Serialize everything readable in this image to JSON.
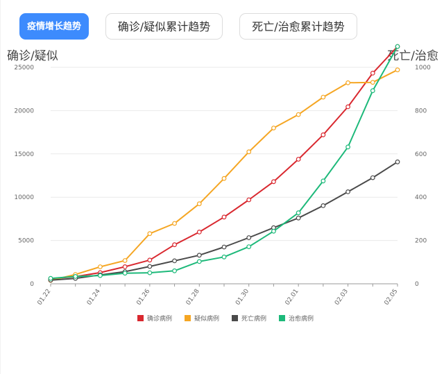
{
  "tabs": [
    {
      "label": "疫情增长趋势",
      "active": true
    },
    {
      "label": "确诊/疑似累计趋势",
      "active": false
    },
    {
      "label": "死亡/治愈累计趋势",
      "active": false
    }
  ],
  "chart_data": {
    "type": "line",
    "left_axis_label": "确诊/疑似",
    "right_axis_label": "死亡/治愈",
    "x": [
      "01.22",
      "01.23",
      "01.24",
      "01.25",
      "01.26",
      "01.27",
      "01.28",
      "01.29",
      "01.30",
      "01.31",
      "02.01",
      "02.02",
      "02.03",
      "02.04",
      "02.05"
    ],
    "x_tick_labels": [
      "01.22",
      "01.24",
      "01.26",
      "01.28",
      "01.30",
      "02.01",
      "02.03",
      "02.05"
    ],
    "left_ylim": [
      0,
      25000
    ],
    "left_ticks": [
      0,
      5000,
      10000,
      15000,
      20000,
      25000
    ],
    "right_ylim": [
      0,
      1000
    ],
    "right_ticks": [
      0,
      200,
      400,
      600,
      800,
      1000
    ],
    "grid": true,
    "legend_position": "bottom",
    "series": [
      {
        "name": "确诊病例",
        "axis": "left",
        "color": "#d9282f",
        "values": [
          571,
          830,
          1287,
          1975,
          2744,
          4515,
          5974,
          7711,
          9692,
          11791,
          14380,
          17205,
          20438,
          24324,
          28018
        ]
      },
      {
        "name": "疑似病例",
        "axis": "left",
        "color": "#f5a623",
        "values": [
          393,
          1072,
          1965,
          2684,
          5794,
          6973,
          9239,
          12167,
          15238,
          17988,
          19544,
          21558,
          23214,
          23260,
          24702
        ]
      },
      {
        "name": "死亡病例",
        "axis": "right",
        "color": "#4a4a4a",
        "values": [
          17,
          25,
          41,
          56,
          80,
          106,
          132,
          170,
          213,
          259,
          304,
          361,
          425,
          490,
          563
        ]
      },
      {
        "name": "治愈病例",
        "axis": "right",
        "color": "#1db97a",
        "values": [
          25,
          34,
          38,
          49,
          51,
          60,
          103,
          124,
          171,
          243,
          328,
          475,
          632,
          892,
          1153
        ]
      }
    ]
  }
}
